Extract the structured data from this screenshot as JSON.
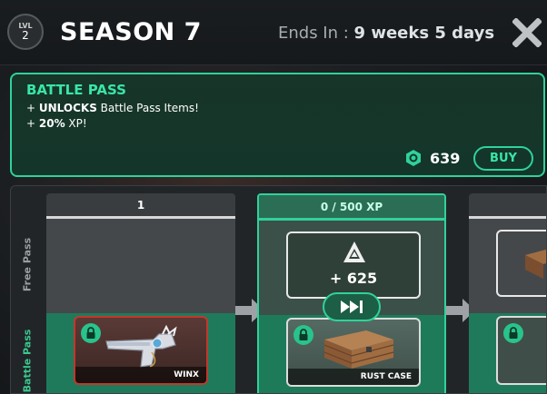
{
  "header": {
    "level_label": "LVL",
    "level_value": "2",
    "season_title": "SEASON 7",
    "ends_in_label": "Ends In : ",
    "ends_weeks": "9",
    "weeks_word": " weeks ",
    "ends_days": "5",
    "days_word": " days",
    "close_icon": "close-x-icon"
  },
  "battle_pass": {
    "title": "BATTLE PASS",
    "line1_prefix": "+ ",
    "line1_bold": "UNLOCKS",
    "line1_rest": " Battle Pass Items!",
    "line2_prefix": "+ ",
    "line2_bold": "20%",
    "line2_rest": " XP!",
    "price": "639",
    "currency_icon": "coin-icon",
    "buy_label": "BUY",
    "accent_color": "#2fd29b"
  },
  "track": {
    "free_row_label": "Free Pass",
    "bp_row_label": "Battle Pass",
    "columns": [
      {
        "header": "1",
        "battle_pass_item": {
          "name": "WINX",
          "locked": true,
          "rarity_color": "#c0392b"
        }
      },
      {
        "header": "0 / 500 XP",
        "current": true,
        "free_reward": {
          "icon": "xp-token-icon",
          "value": "+ 625"
        },
        "skip_icon": "fast-forward-icon",
        "battle_pass_item": {
          "name": "RUST CASE",
          "locked": true
        }
      },
      {
        "header": "",
        "battle_pass_item": {
          "name": "",
          "locked": true
        }
      }
    ]
  }
}
